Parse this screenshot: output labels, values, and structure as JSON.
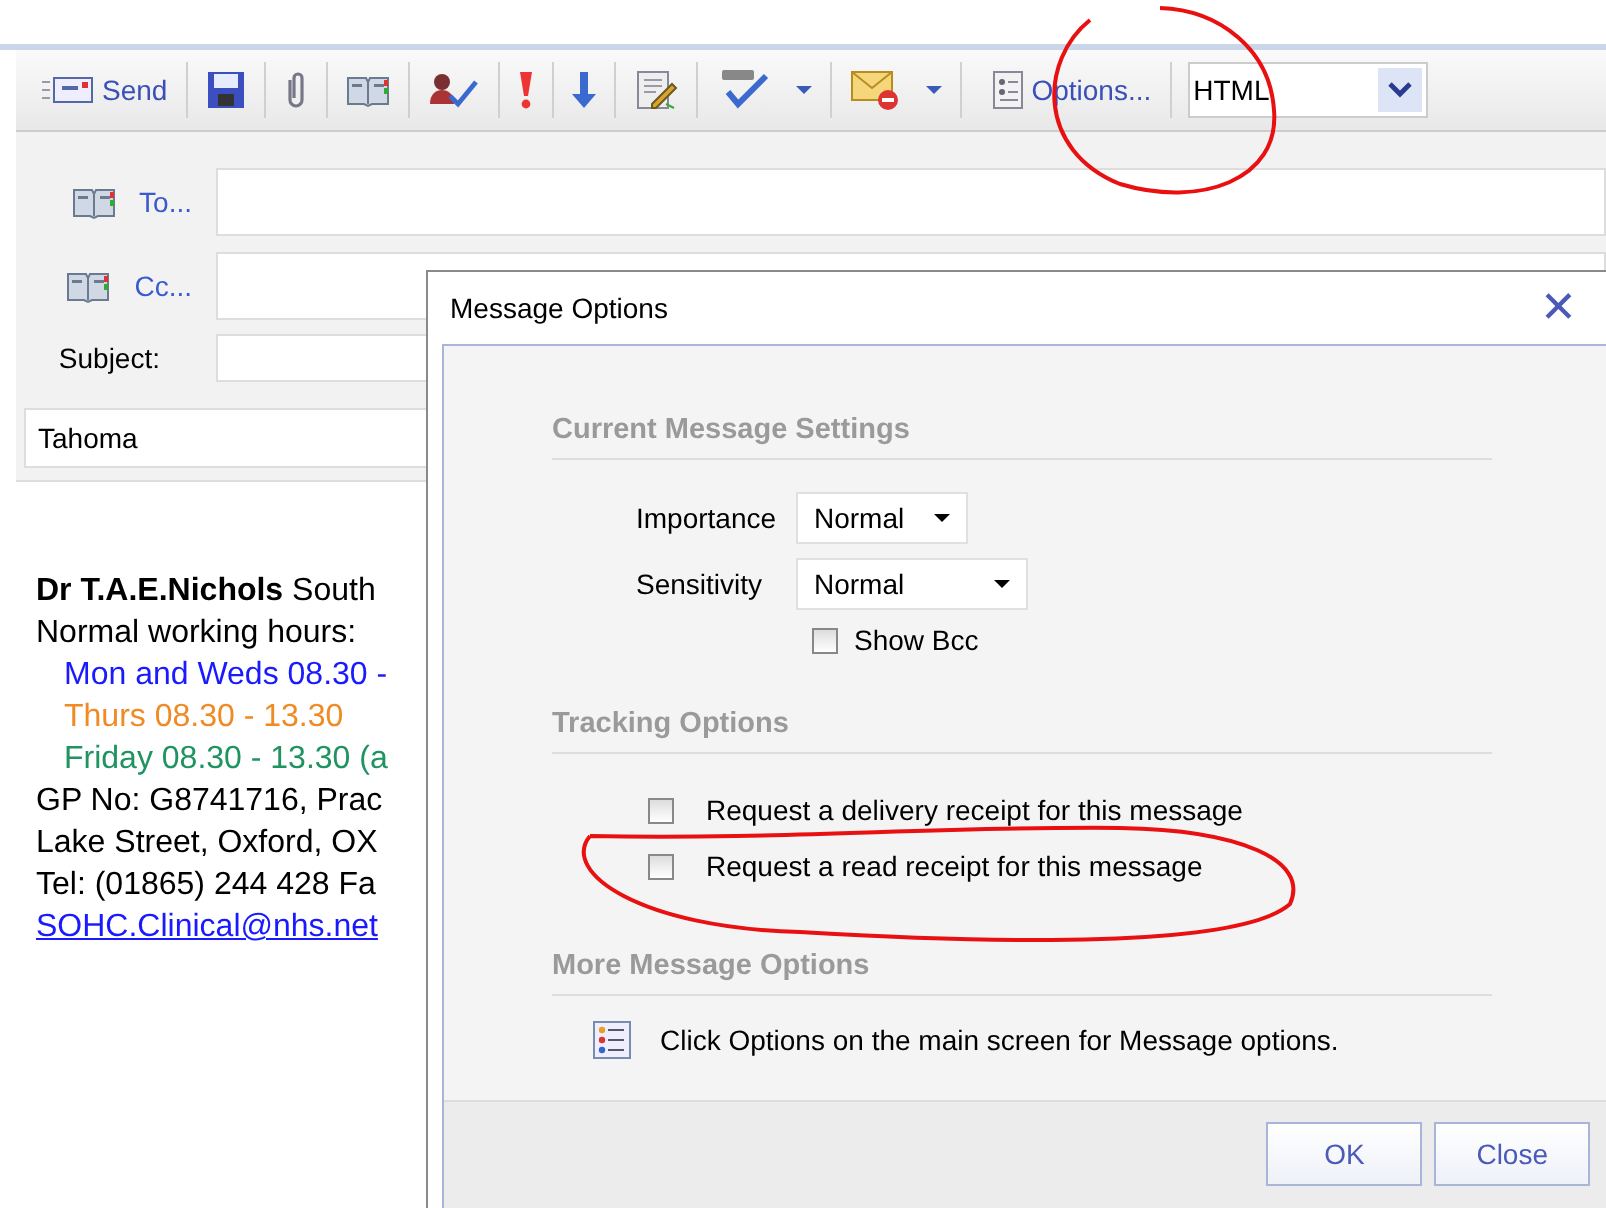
{
  "toolbar": {
    "send": "Send",
    "options": "Options...",
    "format": "HTML"
  },
  "header": {
    "to": "To...",
    "cc": "Cc...",
    "subject": "Subject:",
    "font": "Tahoma"
  },
  "signature": {
    "lines": [
      {
        "text": "**Dr T.A.E.Nichols** South",
        "color": "#000000",
        "indent": false
      },
      {
        "text": "Normal working hours:",
        "color": "#000000",
        "indent": false
      },
      {
        "text": "Mon and Weds 08.30 -",
        "color": "#1a1aff",
        "indent": true
      },
      {
        "text": "Thurs 08.30 - 13.30",
        "color": "#f08a24",
        "indent": true
      },
      {
        "text": "Friday 08.30 - 13.30 (a",
        "color": "#1f9460",
        "indent": true
      },
      {
        "text": "GP No: G8741716, Prac",
        "color": "#000000",
        "indent": false
      },
      {
        "text": "Lake Street, Oxford, OX",
        "color": "#000000",
        "indent": false
      },
      {
        "text": "Tel: (01865) 244 428  Fa",
        "color": "#000000",
        "indent": false
      }
    ],
    "email": "SOHC.Clinical@nhs.net"
  },
  "dialog": {
    "title": "Message Options",
    "close": "✕",
    "current": {
      "heading": "Current Message Settings",
      "importance_label": "Importance",
      "importance": "Normal",
      "sensitivity_label": "Sensitivity",
      "sensitivity": "Normal",
      "show_bcc": {
        "label": "Show Bcc",
        "checked": false
      }
    },
    "tracking": {
      "heading": "Tracking Options",
      "options": [
        {
          "label": "Request a delivery receipt for this message",
          "checked": false
        },
        {
          "label": "Request a read receipt for this message",
          "checked": false
        }
      ]
    },
    "more": {
      "heading": "More Message Options",
      "text": "Click Options on the main screen for Message options."
    },
    "buttons": [
      "OK",
      "Close"
    ]
  }
}
